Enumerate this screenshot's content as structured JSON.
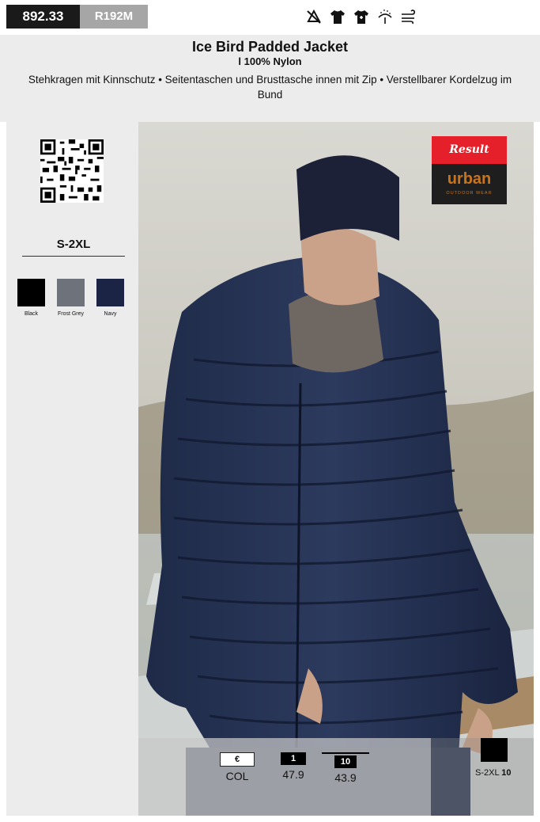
{
  "header": {
    "article_number": "892.33",
    "reference": "R192M",
    "care_icons": [
      "no-bleach-icon",
      "shirt-icon",
      "shirt-plus-icon",
      "rain-icon",
      "wind-icon"
    ]
  },
  "product": {
    "title": "Ice Bird Padded Jacket",
    "material": "l 100% Nylon",
    "description": "Stehkragen mit Kinnschutz • Seitentaschen und Brusttasche innen mit Zip • Verstellbarer Kordelzug im Bund"
  },
  "sidebar": {
    "sizes": "S-2XL",
    "colors": [
      {
        "name": "Black",
        "hex": "#000000"
      },
      {
        "name": "Frost Grey",
        "hex": "#6e737b"
      },
      {
        "name": "Navy",
        "hex": "#1b2444"
      }
    ]
  },
  "brand": {
    "top": "Result",
    "name": "urban",
    "tagline": "OUTDOOR WEAR"
  },
  "pricing": {
    "currency": "€",
    "col_label": "COL",
    "tiers": [
      {
        "qty": "1",
        "price": "47.9"
      },
      {
        "qty": "10",
        "price": "43.9"
      }
    ],
    "pack": {
      "sizes": "S-2XL",
      "qty": "10"
    }
  }
}
